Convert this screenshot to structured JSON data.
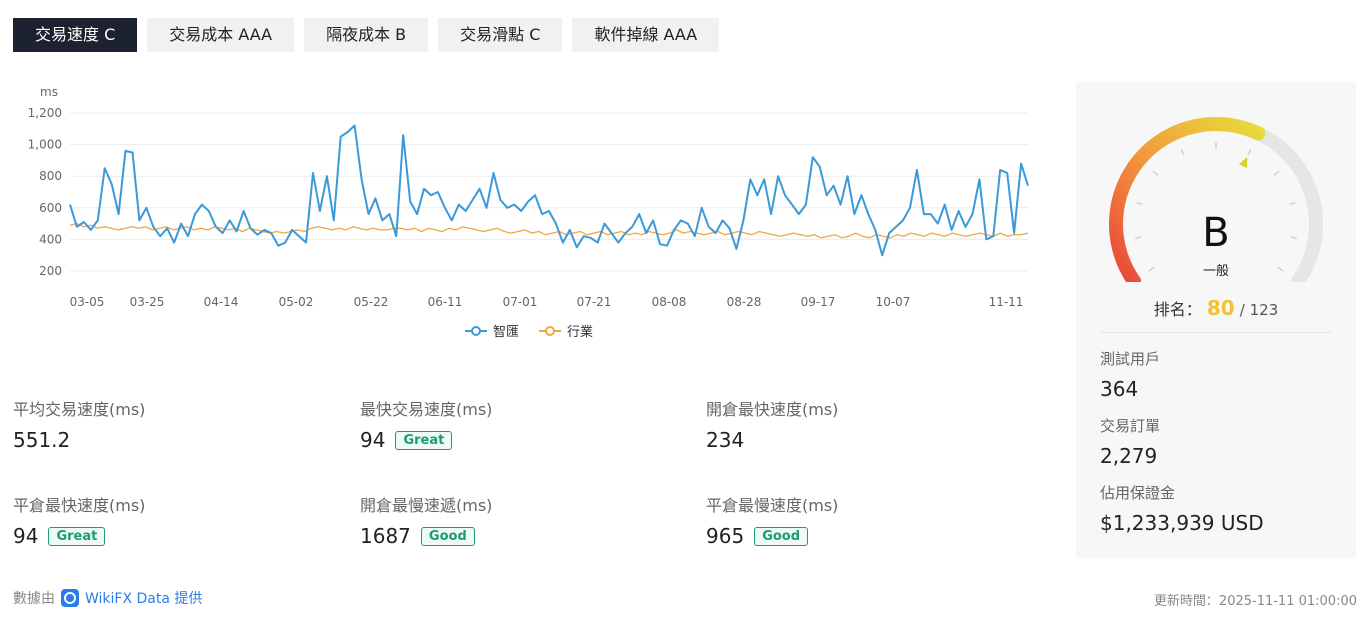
{
  "tabs": [
    {
      "label": "交易速度 C",
      "active": true
    },
    {
      "label": "交易成本 AAA",
      "active": false
    },
    {
      "label": "隔夜成本 B",
      "active": false
    },
    {
      "label": "交易滑點 C",
      "active": false
    },
    {
      "label": "軟件掉線 AAA",
      "active": false
    }
  ],
  "chart_data": {
    "type": "line",
    "ylabel": "ms",
    "ylim": [
      200,
      1200
    ],
    "yticks": [
      "1,200",
      "1,000",
      "800",
      "600",
      "400",
      "200"
    ],
    "xticks": [
      "03-05",
      "03-25",
      "04-14",
      "05-02",
      "05-22",
      "06-11",
      "07-01",
      "07-21",
      "08-08",
      "08-28",
      "09-17",
      "10-07",
      "11-11"
    ],
    "grid": true,
    "legend_position": "bottom",
    "series": [
      {
        "name": "智匯",
        "color": "#3a9ad9",
        "values": [
          620,
          480,
          510,
          460,
          520,
          850,
          750,
          560,
          960,
          950,
          520,
          600,
          480,
          420,
          470,
          380,
          500,
          420,
          560,
          620,
          580,
          480,
          440,
          520,
          450,
          580,
          470,
          430,
          460,
          440,
          360,
          380,
          460,
          420,
          380,
          820,
          580,
          800,
          520,
          1050,
          1080,
          1120,
          780,
          560,
          660,
          520,
          560,
          420,
          1060,
          640,
          560,
          720,
          680,
          700,
          600,
          520,
          620,
          580,
          650,
          720,
          600,
          820,
          650,
          600,
          620,
          580,
          640,
          680,
          560,
          580,
          500,
          380,
          460,
          350,
          420,
          410,
          380,
          500,
          440,
          380,
          440,
          480,
          560,
          440,
          520,
          370,
          360,
          460,
          520,
          500,
          420,
          600,
          480,
          440,
          520,
          470,
          340,
          520,
          780,
          680,
          780,
          560,
          800,
          680,
          620,
          560,
          620,
          920,
          860,
          680,
          740,
          620,
          800,
          560,
          680,
          560,
          460,
          300,
          440,
          480,
          520,
          600,
          840,
          560,
          560,
          500,
          620,
          460,
          580,
          480,
          560,
          780,
          400,
          420,
          840,
          820,
          440,
          880,
          740
        ]
      },
      {
        "name": "行業",
        "color": "#f0a642",
        "values": [
          490,
          500,
          480,
          490,
          470,
          480,
          470,
          460,
          470,
          480,
          470,
          480,
          460,
          470,
          480,
          460,
          470,
          480,
          460,
          470,
          460,
          480,
          470,
          460,
          470,
          450,
          470,
          460,
          450,
          440,
          450,
          440,
          450,
          460,
          450,
          470,
          480,
          470,
          460,
          470,
          460,
          480,
          470,
          460,
          470,
          460,
          460,
          470,
          470,
          460,
          470,
          450,
          470,
          460,
          450,
          470,
          460,
          480,
          470,
          460,
          450,
          460,
          470,
          450,
          440,
          450,
          460,
          440,
          450,
          430,
          440,
          450,
          430,
          440,
          450,
          430,
          440,
          450,
          430,
          440,
          450,
          430,
          440,
          430,
          450,
          440,
          430,
          440,
          460,
          440,
          450,
          440,
          430,
          440,
          450,
          430,
          440,
          450,
          440,
          430,
          450,
          440,
          430,
          420,
          430,
          440,
          430,
          420,
          430,
          410,
          420,
          430,
          410,
          420,
          440,
          420,
          410,
          430,
          420,
          410,
          430,
          420,
          440,
          430,
          420,
          440,
          430,
          420,
          440,
          430,
          420,
          430,
          440,
          430,
          420,
          440,
          420,
          430,
          430,
          440
        ]
      }
    ]
  },
  "stats": [
    {
      "label": "平均交易速度(ms)",
      "value": "551.2",
      "badge": ""
    },
    {
      "label": "最快交易速度(ms)",
      "value": "94",
      "badge": "Great"
    },
    {
      "label": "開倉最快速度(ms)",
      "value": "234",
      "badge": ""
    },
    {
      "label": "平倉最快速度(ms)",
      "value": "94",
      "badge": "Great"
    },
    {
      "label": "開倉最慢速遞(ms)",
      "value": "1687",
      "badge": "Good"
    },
    {
      "label": "平倉最慢速度(ms)",
      "value": "965",
      "badge": "Good"
    }
  ],
  "panel": {
    "grade": "B",
    "grade_sub": "一般",
    "rank_label": "排名：",
    "rank_value": "80",
    "rank_total": "/ 123",
    "gauge_level": 0.6,
    "info": [
      {
        "label": "測試用戶",
        "value": "364"
      },
      {
        "label": "交易訂單",
        "value": "2,279"
      },
      {
        "label": "佔用保證金",
        "value": "$1,233,939 USD"
      }
    ]
  },
  "footer": {
    "source_prefix": "數據由",
    "source_brand": "WikiFX Data 提供",
    "updated": "更新時間：2025-11-11 01:00:00"
  }
}
